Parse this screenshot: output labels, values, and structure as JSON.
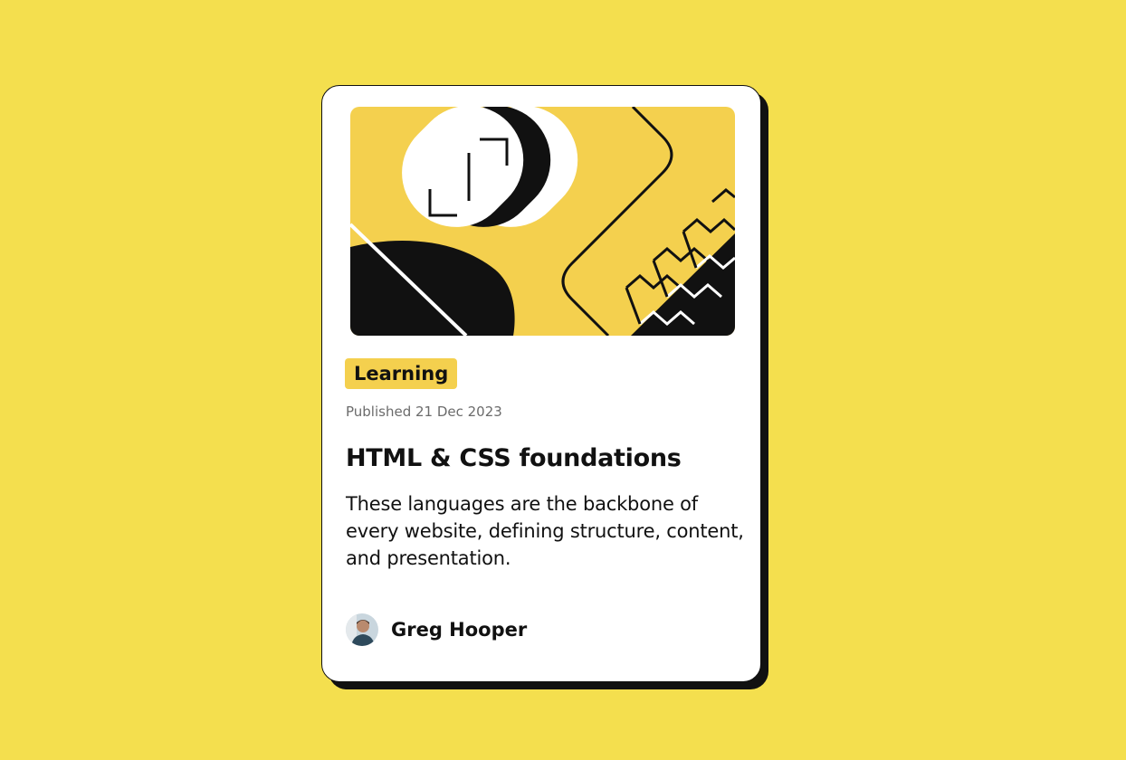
{
  "card": {
    "image_alt": "Abstract HTML & CSS illustration",
    "category": "Learning",
    "published": "Published 21 Dec 2023",
    "title": "HTML & CSS foundations",
    "description": "These languages are the backbone of every website, defining structure, content, and presentation.",
    "author": {
      "name": "Greg Hooper",
      "avatar": "author-avatar-photo"
    }
  },
  "colors": {
    "background": "#F4DF4E",
    "card": "#FFFFFF",
    "accent_yellow": "#F4D04E",
    "shadow_black": "#111111",
    "muted_text": "#6B6B6B"
  },
  "icons": [
    "illustration-graphic",
    "author-avatar"
  ]
}
